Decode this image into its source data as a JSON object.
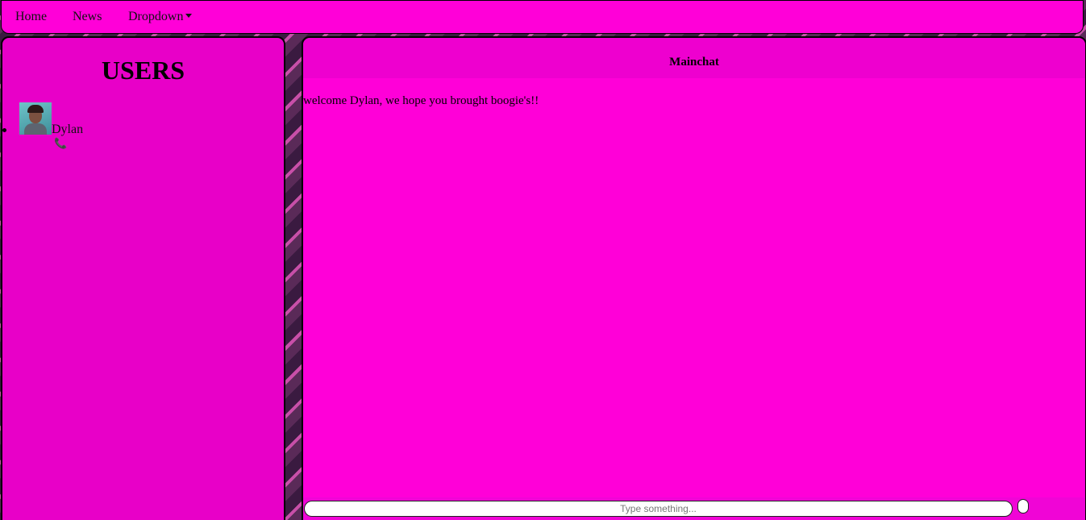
{
  "nav": {
    "home_label": "Home",
    "news_label": "News",
    "dropdown_label": "Dropdown"
  },
  "users": {
    "title": "USERS",
    "list": [
      {
        "name": "Dylan",
        "avatar_icon": "avatar-image",
        "call_icon": "phone-icon"
      }
    ]
  },
  "chat": {
    "title": "Mainchat",
    "messages": [
      "welcome Dylan, we hope you brought boogie's!!"
    ],
    "input_placeholder": "Type something...",
    "input_value": ""
  },
  "colors": {
    "panel_magenta": "#ff00d8",
    "users_panel": "#e800c8",
    "background_dark": "#3a1a40"
  }
}
